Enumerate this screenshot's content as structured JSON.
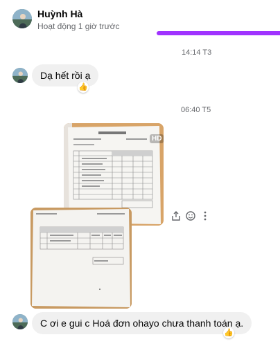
{
  "header": {
    "name": "Huỳnh Hà",
    "status": "Hoạt động 1 giờ trước"
  },
  "messages": [
    {
      "timestamp": "14:14 T3",
      "text": "Dạ hết rồi ạ",
      "reaction": "👍"
    },
    {
      "timestamp": "06:40 T5",
      "photos": [
        {
          "badge": "HD"
        },
        {}
      ]
    },
    {
      "text": "C ơi e gui c  Hoá đơn ohayo chưa thanh toán ạ.",
      "reaction": "👍"
    }
  ],
  "photo_actions": [
    "share-icon",
    "emoji-icon",
    "more-icon"
  ]
}
